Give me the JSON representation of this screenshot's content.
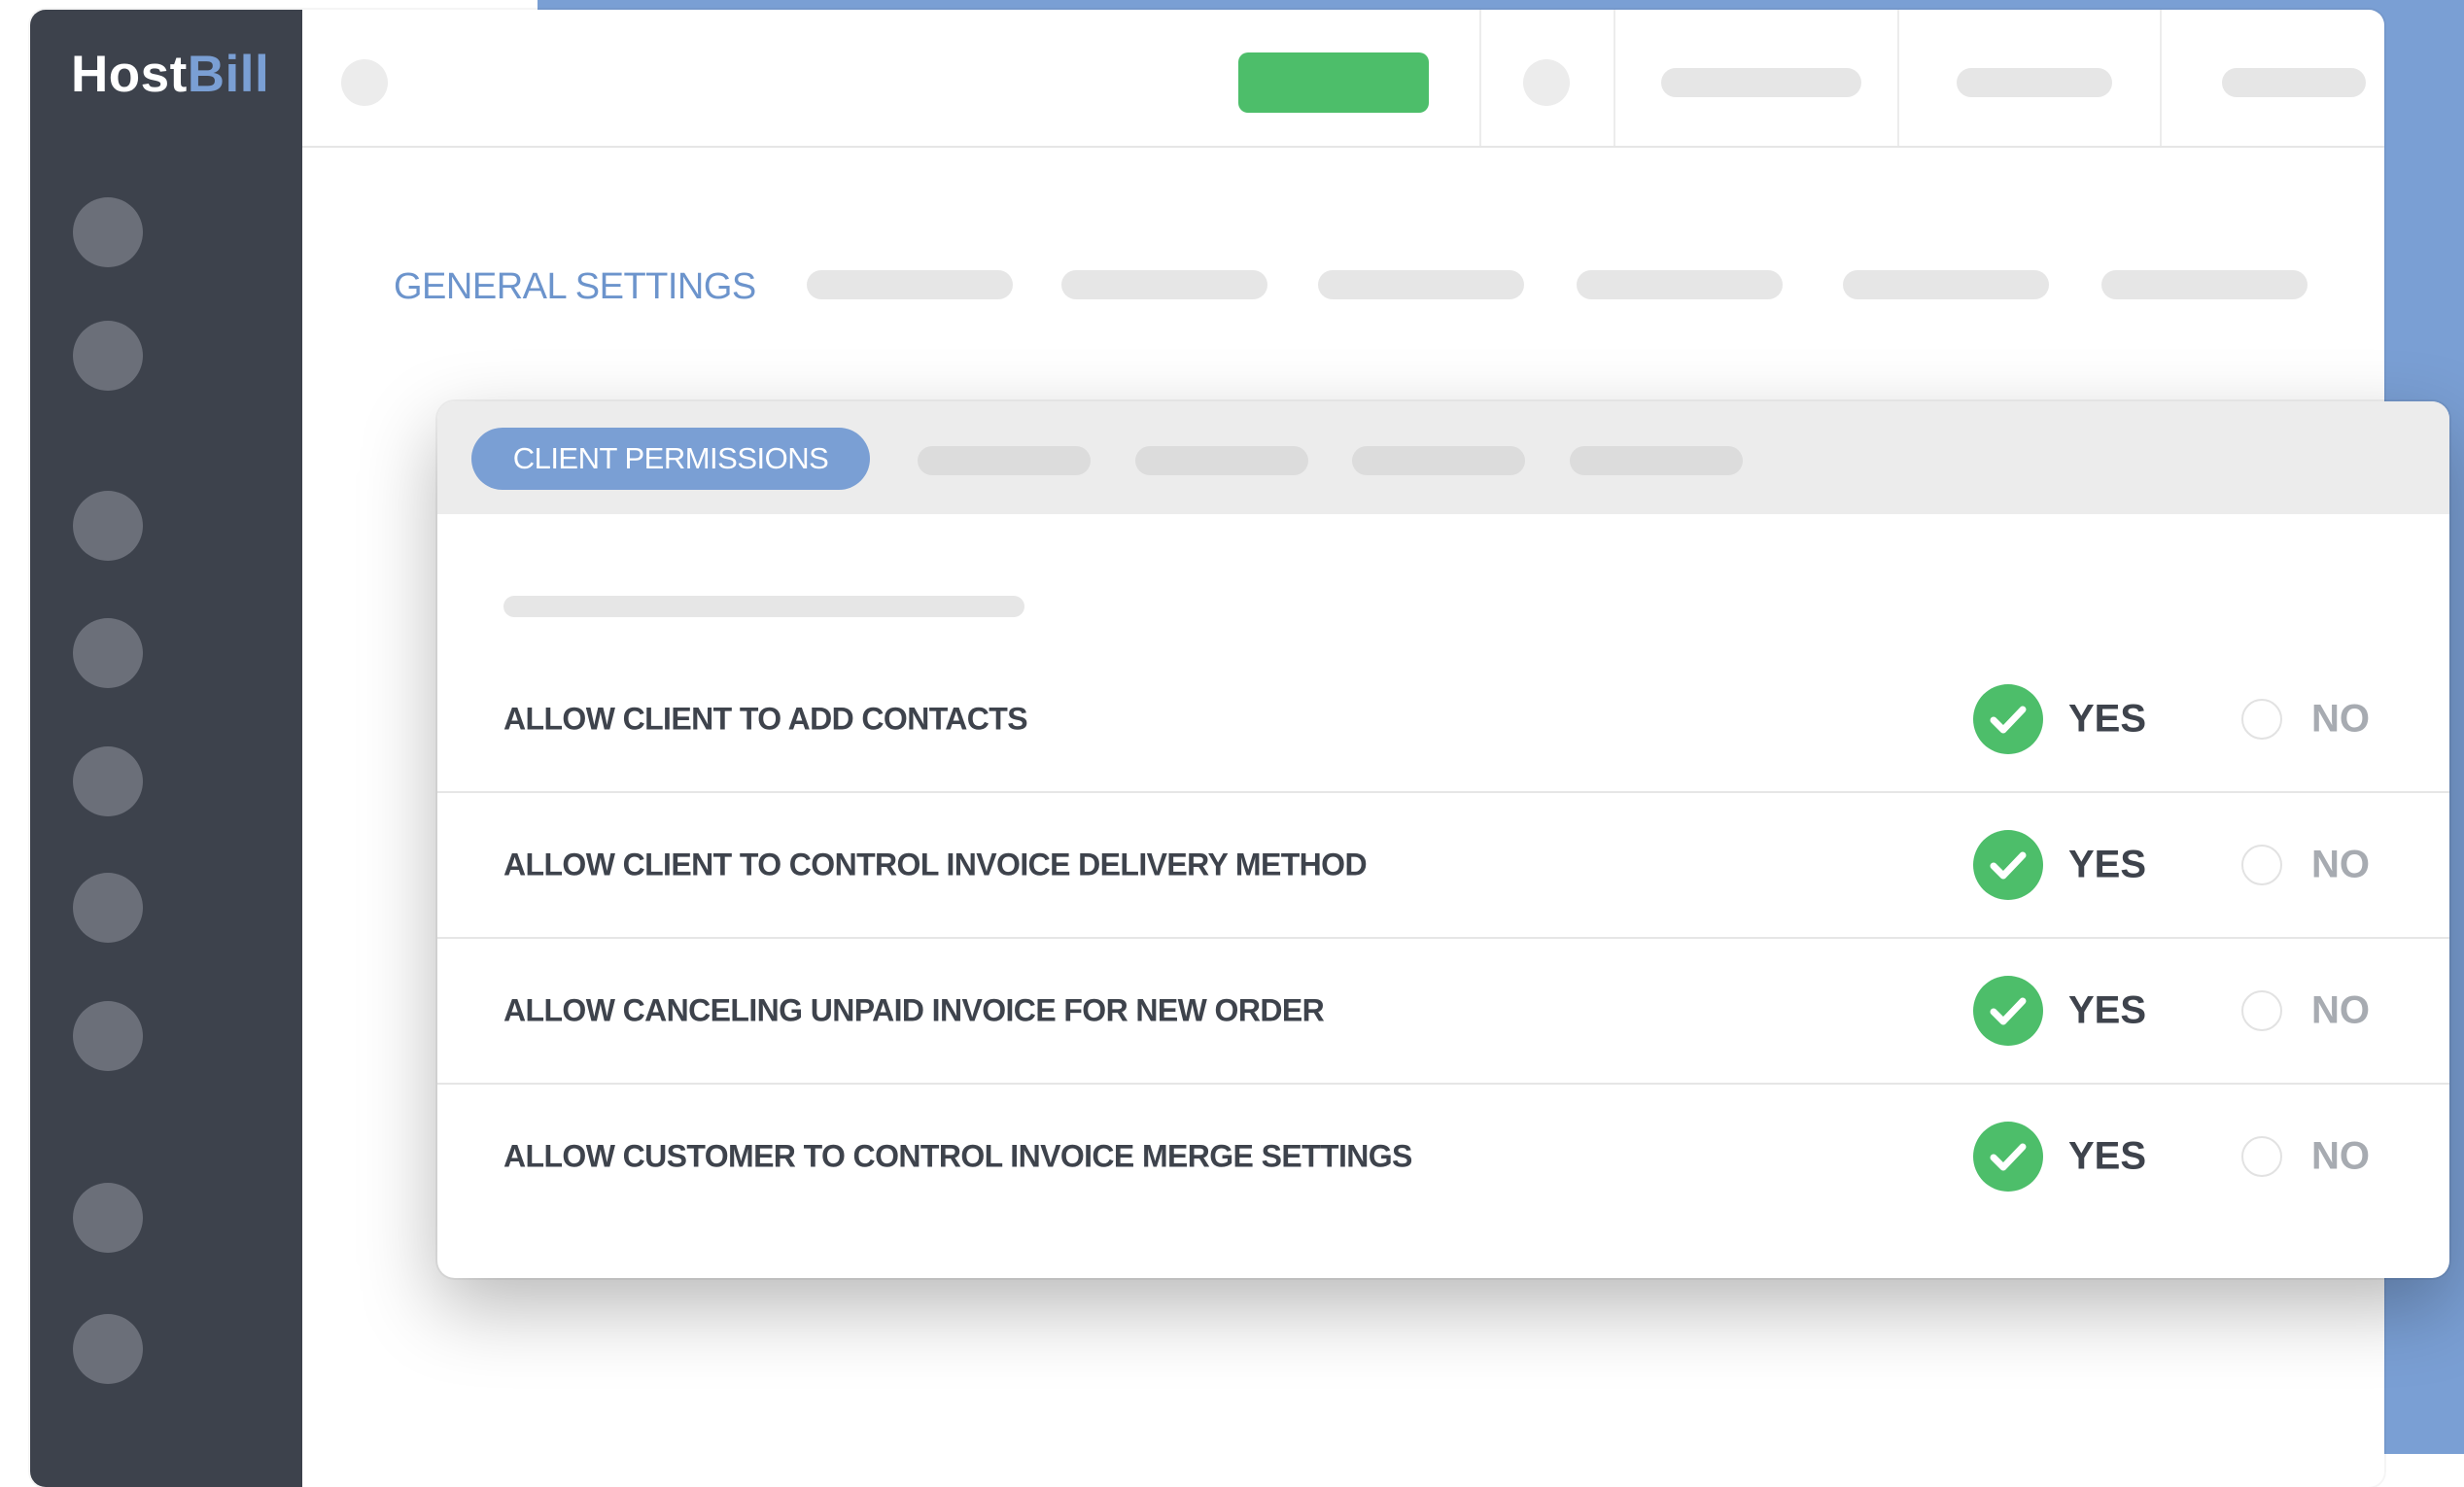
{
  "app": {
    "logo_host": "Host",
    "logo_bill": "Bill"
  },
  "header": {
    "section_title": "GENERAL SETTINGS"
  },
  "card": {
    "active_tab": "CLIENT PERMISSIONS",
    "permissions": [
      {
        "label": "ALLOW CLIENT TO ADD CONTACTS",
        "yes": "YES",
        "no": "NO",
        "selected": "YES"
      },
      {
        "label": "ALLOW CLIENT TO CONTROL INVOICE DELIVERY METHOD",
        "yes": "YES",
        "no": "NO",
        "selected": "YES"
      },
      {
        "label": "ALLOW CANCELING UNPAID INVOICE FOR NEW ORDER",
        "yes": "YES",
        "no": "NO",
        "selected": "YES"
      },
      {
        "label": "ALLOW CUSTOMER TO CONTROL INVOICE MERGE SETTINGS",
        "yes": "YES",
        "no": "NO",
        "selected": "YES"
      }
    ]
  },
  "colors": {
    "accent_blue": "#7a9fd4",
    "sidebar": "#3d424c",
    "success_green": "#4dbe6a",
    "placeholder_gray": "#e6e6e6"
  }
}
